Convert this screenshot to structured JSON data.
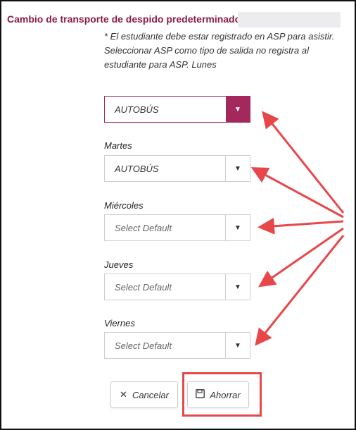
{
  "dialog": {
    "title": "Cambio de transporte de despido predeterminado para",
    "note": "* El estudiante debe estar registrado en ASP para asistir. Seleccionar ASP como tipo de salida no registra al estudiante para ASP. Lunes"
  },
  "days": [
    {
      "label": "",
      "value": "AUTOBÚS",
      "placeholder": false
    },
    {
      "label": "Martes",
      "value": "AUTOBÚS",
      "placeholder": false
    },
    {
      "label": "Miércoles",
      "value": "Select Default",
      "placeholder": true
    },
    {
      "label": "Jueves",
      "value": "Select Default",
      "placeholder": true
    },
    {
      "label": "Viernes",
      "value": "Select Default",
      "placeholder": true
    }
  ],
  "buttons": {
    "cancel_label": "Cancelar",
    "save_label": "Ahorrar"
  },
  "icons": {
    "cancel": "close-icon",
    "save": "floppy-disk-icon",
    "dropdown": "caret-down-icon"
  },
  "colors": {
    "brand": "#8b1d47",
    "active_select": "#a3295d",
    "annotation": "#e8474a"
  }
}
